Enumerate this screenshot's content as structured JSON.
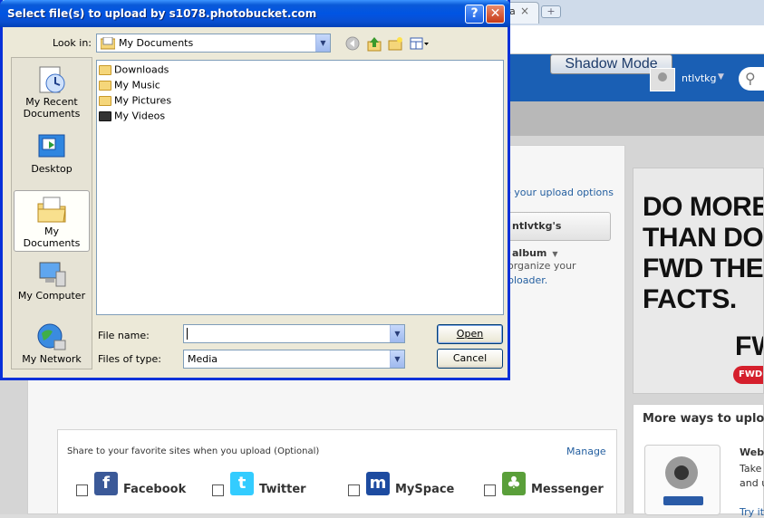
{
  "browser": {
    "tab_text": "a",
    "tab_close": "×",
    "new_tab": "+"
  },
  "site": {
    "shadow_mode": "Shadow Mode",
    "username": "ntlvtkg",
    "upload_options_link": "e your upload options",
    "album_select": "ntlvtkg's album",
    "organize_line1": "organize your",
    "organize_line2": "ploader."
  },
  "ad": {
    "line1": "DO MORE",
    "line2": "THAN DO",
    "line3": "FWD THE",
    "line4": "FACTS.",
    "fw": "FW",
    "fwd": "FWD"
  },
  "more_ways": {
    "title": "More ways to uploa",
    "line1": "Webc",
    "line2": "Take",
    "line3": "and u",
    "line4": "Try it"
  },
  "share": {
    "text": "Share to your favorite sites when you upload (Optional)",
    "manage": "Manage",
    "items": [
      {
        "label": "Facebook",
        "icon": "f",
        "color": "#3b5998"
      },
      {
        "label": "Twitter",
        "icon": "t",
        "color": "#33ccff"
      },
      {
        "label": "MySpace",
        "icon": "m",
        "color": "#1d4ba0"
      },
      {
        "label": "Messenger",
        "icon": "♣",
        "color": "#5a9f3a"
      }
    ]
  },
  "dialog": {
    "title": "Select file(s) to upload by s1078.photobucket.com",
    "help": "?",
    "close": "✕",
    "look_in_label": "Look in:",
    "look_in_value": "My Documents",
    "places": [
      {
        "label": "My Recent Documents"
      },
      {
        "label": "Desktop"
      },
      {
        "label": "My Documents"
      },
      {
        "label": "My Computer"
      },
      {
        "label": "My Network"
      }
    ],
    "files": [
      {
        "name": "Downloads"
      },
      {
        "name": "My Music"
      },
      {
        "name": "My Pictures"
      },
      {
        "name": "My Videos"
      }
    ],
    "file_name_label": "File name:",
    "file_name_value": "",
    "files_of_type_label": "Files of type:",
    "files_of_type_value": "Media",
    "open_button": "Open",
    "cancel_button": "Cancel"
  }
}
